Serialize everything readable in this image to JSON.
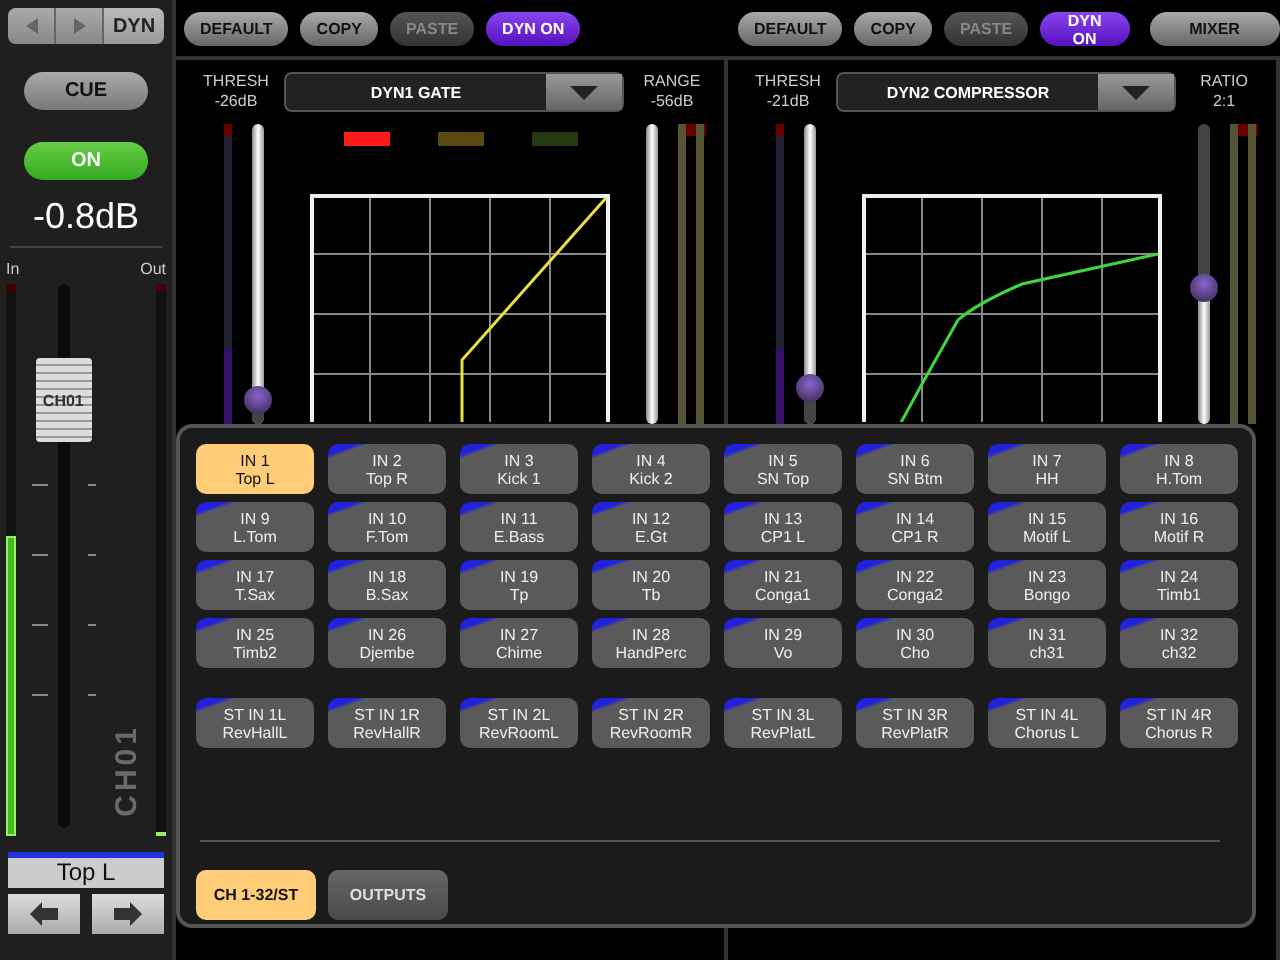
{
  "channel_strip": {
    "mode": "DYN",
    "cue": {
      "label": "CUE",
      "on": false
    },
    "on_button": {
      "label": "ON",
      "on": true
    },
    "level": "-0.8dB",
    "meter_in": {
      "label": "In",
      "level": 0.55
    },
    "meter_out": {
      "label": "Out",
      "level": 0
    },
    "fader": {
      "cap_label": "CH01",
      "level": 0.84
    },
    "channel_id": "CH01",
    "name": "Top L"
  },
  "toolbars": [
    [
      {
        "label": "DEFAULT",
        "disabled": false,
        "on": false
      },
      {
        "label": "COPY",
        "disabled": false,
        "on": false
      },
      {
        "label": "PASTE",
        "disabled": true,
        "on": false
      },
      {
        "label": "DYN ON",
        "disabled": false,
        "on": true
      }
    ],
    [
      {
        "label": "DEFAULT",
        "disabled": false,
        "on": false
      },
      {
        "label": "COPY",
        "disabled": false,
        "on": false
      },
      {
        "label": "PASTE",
        "disabled": true,
        "on": false
      },
      {
        "label": "DYN ON",
        "disabled": false,
        "on": true
      },
      {
        "label": "MIXER",
        "disabled": false,
        "on": false
      }
    ]
  ],
  "dyn_panels": [
    {
      "kind": "gate",
      "name": "DYN1 GATE",
      "left_param": {
        "label": "THRESH",
        "value": "-26dB",
        "level": 0.04
      },
      "right_param": {
        "label": "RANGE",
        "value": "-56dB"
      },
      "lamps": [
        {
          "color": "#ff1a1a"
        },
        {
          "color": "#5a4a12"
        },
        {
          "color": "#233a12"
        }
      ]
    },
    {
      "kind": "compressor",
      "name": "DYN2 COMPRESSOR",
      "left_param": {
        "label": "THRESH",
        "value": "-21dB",
        "level": 0.08
      },
      "right_param": {
        "label": "RATIO",
        "value": "2:1",
        "level": 0.45
      }
    }
  ],
  "channel_select": {
    "channels": [
      {
        "number": "IN 1",
        "name": "Top L",
        "selected": true
      },
      {
        "number": "IN 2",
        "name": "Top R",
        "selected": false
      },
      {
        "number": "IN 3",
        "name": "Kick 1",
        "selected": false
      },
      {
        "number": "IN 4",
        "name": "Kick 2",
        "selected": false
      },
      {
        "number": "IN 5",
        "name": "SN Top",
        "selected": false
      },
      {
        "number": "IN 6",
        "name": "SN Btm",
        "selected": false
      },
      {
        "number": "IN 7",
        "name": "HH",
        "selected": false
      },
      {
        "number": "IN 8",
        "name": "H.Tom",
        "selected": false
      },
      {
        "number": "IN 9",
        "name": "L.Tom",
        "selected": false
      },
      {
        "number": "IN 10",
        "name": "F.Tom",
        "selected": false
      },
      {
        "number": "IN 11",
        "name": "E.Bass",
        "selected": false
      },
      {
        "number": "IN 12",
        "name": "E.Gt",
        "selected": false
      },
      {
        "number": "IN 13",
        "name": "CP1 L",
        "selected": false
      },
      {
        "number": "IN 14",
        "name": "CP1 R",
        "selected": false
      },
      {
        "number": "IN 15",
        "name": "Motif L",
        "selected": false
      },
      {
        "number": "IN 16",
        "name": "Motif R",
        "selected": false
      },
      {
        "number": "IN 17",
        "name": "T.Sax",
        "selected": false
      },
      {
        "number": "IN 18",
        "name": "B.Sax",
        "selected": false
      },
      {
        "number": "IN 19",
        "name": "Tp",
        "selected": false
      },
      {
        "number": "IN 20",
        "name": "Tb",
        "selected": false
      },
      {
        "number": "IN 21",
        "name": "Conga1",
        "selected": false
      },
      {
        "number": "IN 22",
        "name": "Conga2",
        "selected": false
      },
      {
        "number": "IN 23",
        "name": "Bongo",
        "selected": false
      },
      {
        "number": "IN 24",
        "name": "Timb1",
        "selected": false
      },
      {
        "number": "IN 25",
        "name": "Timb2",
        "selected": false
      },
      {
        "number": "IN 26",
        "name": "Djembe",
        "selected": false
      },
      {
        "number": "IN 27",
        "name": "Chime",
        "selected": false
      },
      {
        "number": "IN 28",
        "name": "HandPerc",
        "selected": false
      },
      {
        "number": "IN 29",
        "name": "Vo",
        "selected": false
      },
      {
        "number": "IN 30",
        "name": "Cho",
        "selected": false
      },
      {
        "number": "IN 31",
        "name": "ch31",
        "selected": false
      },
      {
        "number": "IN 32",
        "name": "ch32",
        "selected": false
      }
    ],
    "stereo_inputs": [
      {
        "number": "ST IN 1L",
        "name": "RevHallL",
        "selected": false
      },
      {
        "number": "ST IN 1R",
        "name": "RevHallR",
        "selected": false
      },
      {
        "number": "ST IN 2L",
        "name": "RevRoomL",
        "selected": false
      },
      {
        "number": "ST IN 2R",
        "name": "RevRoomR",
        "selected": false
      },
      {
        "number": "ST IN 3L",
        "name": "RevPlatL",
        "selected": false
      },
      {
        "number": "ST IN 3R",
        "name": "RevPlatR",
        "selected": false
      },
      {
        "number": "ST IN 4L",
        "name": "Chorus L",
        "selected": false
      },
      {
        "number": "ST IN 4R",
        "name": "Chorus R",
        "selected": false
      }
    ],
    "tabs": [
      {
        "label": "CH 1-32/ST",
        "selected": true
      },
      {
        "label": "OUTPUTS",
        "selected": false
      }
    ]
  }
}
